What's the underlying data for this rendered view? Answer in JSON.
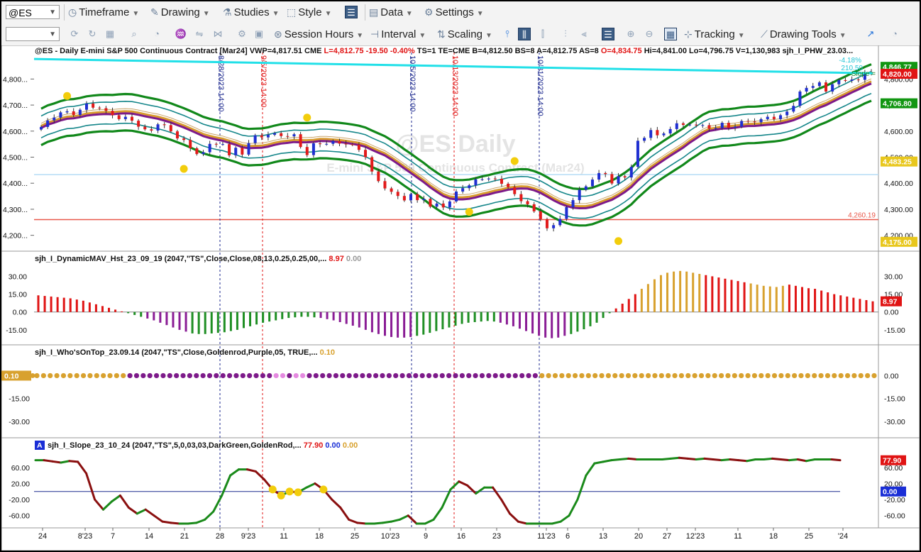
{
  "toolbar1": {
    "symbol": "@ES",
    "timeframe": "Timeframe",
    "drawing": "Drawing",
    "studies": "Studies",
    "style": "Style",
    "data": "Data",
    "settings": "Settings"
  },
  "toolbar2": {
    "session_hours": "Session Hours",
    "interval": "Interval",
    "scaling": "Scaling",
    "tracking": "Tracking",
    "drawing_tools": "Drawing Tools"
  },
  "chart_data": [
    {
      "type": "candlestick",
      "pane": "price",
      "header": [
        "@ES - Daily",
        "E-mini S&P 500 Continuous Contract [Mar24]",
        "VWP=4,817.51",
        "CME",
        "L=4,812.75",
        "-19.50",
        "-0.40%",
        "TS=1",
        "TE=CME",
        "B=4,812.50",
        "BS=8",
        "A=4,812.75",
        "AS=8",
        "O=4,834.75",
        "Hi=4,841.00",
        "Lo=4,796.75",
        "V=1,130,983",
        "sjh_I_PHW_23.03..."
      ],
      "watermark": [
        "@ES Daily",
        "E-mini S&P 500 Continuous Contract (Mar24)"
      ],
      "ylim": [
        4150,
        4880
      ],
      "y_ticks": [
        "4,800...",
        "4,700...",
        "4,600...",
        "4,500...",
        "4,400...",
        "4,300...",
        "4,200..."
      ],
      "right_ticks": [
        "4,800.00",
        "4,700.00",
        "4,600.00",
        "4,500.00",
        "4,400.00",
        "4,300.00",
        "4,200.00"
      ],
      "right_markers": [
        {
          "label": "4,846.77",
          "value": 4846.77,
          "color": "#119611"
        },
        {
          "label": "4,820.00",
          "value": 4820,
          "color": "#e01414"
        },
        {
          "label": "4,706.80",
          "value": 4706.8,
          "color": "#119611"
        },
        {
          "label": "4,483.25",
          "value": 4483.25,
          "color": "#e8c71d"
        },
        {
          "label": "4,175.00",
          "value": 4175,
          "color": "#e8c71d"
        }
      ],
      "horizontal_lines": [
        {
          "value": 4260.19,
          "label": "4,260.19",
          "color": "#e8584a"
        },
        {
          "value": 4433,
          "color": "#b5dcf5"
        }
      ],
      "trendline_labels": [
        "-4.18%",
        "210.50",
        "Slope ="
      ],
      "vertical_markers": [
        {
          "label": "8/28/2023 14:00",
          "color": "#1d2a8f"
        },
        {
          "label": "9/5/2023 14:00",
          "color": "#e01414"
        },
        {
          "label": "10/5/2023 14:00",
          "color": "#1d2a8f"
        },
        {
          "label": "10/13/2023 14:00",
          "color": "#e01414"
        },
        {
          "label": "10/31/2023 14:00",
          "color": "#1d2a8f"
        }
      ],
      "close": [
        4616,
        4641,
        4652,
        4672,
        4676,
        4662,
        4682,
        4706,
        4690,
        4688,
        4678,
        4661,
        4646,
        4655,
        4640,
        4617,
        4607,
        4602,
        4626,
        4623,
        4599,
        4572,
        4566,
        4534,
        4512,
        4519,
        4551,
        4550,
        4550,
        4507,
        4536,
        4510,
        4554,
        4584,
        4576,
        4586,
        4592,
        4581,
        4580,
        4588,
        4539,
        4508,
        4553,
        4550,
        4551,
        4562,
        4552,
        4549,
        4548,
        4528,
        4500,
        4445,
        4408,
        4380,
        4367,
        4351,
        4334,
        4358,
        4335,
        4340,
        4310,
        4322,
        4307,
        4330,
        4368,
        4381,
        4392,
        4415,
        4415,
        4418,
        4417,
        4398,
        4385,
        4358,
        4331,
        4319,
        4292,
        4262,
        4227,
        4239,
        4263,
        4308,
        4335,
        4375,
        4388,
        4414,
        4439,
        4435,
        4399,
        4427,
        4422,
        4463,
        4563,
        4574,
        4604,
        4584,
        4591,
        4608,
        4630,
        4624,
        4625,
        4622,
        4623,
        4609,
        4612,
        4632,
        4613,
        4617,
        4639,
        4637,
        4634,
        4646,
        4655,
        4646,
        4661,
        4675,
        4697,
        4752,
        4766,
        4773,
        4787,
        4752,
        4780,
        4796,
        4793,
        4798,
        4797,
        4826,
        4820
      ],
      "bands_last": {
        "top_green": 4846.77,
        "bottom_green": 4706.8
      }
    },
    {
      "type": "bar",
      "pane": "sjh_I_DynamicMAV_Hst",
      "label": "sjh_I_DynamicMAV_Hst_23_09_19 (2047,\"TS\",Close,Close,08,13,0.25,0.25,00,...",
      "values_text": [
        "8.97",
        "0.00"
      ],
      "ylim": [
        -24,
        38
      ],
      "ticks": [
        "30.00",
        "15.00",
        "0.00",
        "-15.00"
      ],
      "last": 8.97,
      "last_label": "8.97",
      "values": [
        14,
        13.5,
        13,
        12.5,
        12,
        11.5,
        10.5,
        9.5,
        8,
        6.5,
        5,
        3.5,
        2,
        0.5,
        -1,
        -2.5,
        -4,
        -5.5,
        -7,
        -9,
        -11,
        -13,
        -15,
        -16.5,
        -18,
        -18.5,
        -18.5,
        -18,
        -17.5,
        -17,
        -16,
        -15,
        -13.5,
        -12,
        -10.5,
        -9,
        -8,
        -7,
        -6,
        -5,
        -4.5,
        -4,
        -4,
        -4.5,
        -5,
        -6,
        -7,
        -8.5,
        -10,
        -11.5,
        -13,
        -15,
        -17,
        -18.5,
        -20,
        -21,
        -21.5,
        -21.5,
        -21,
        -20,
        -19,
        -17.5,
        -16,
        -14.5,
        -13,
        -11.5,
        -10,
        -9,
        -8.5,
        -8,
        -7.5,
        -8,
        -9,
        -10.5,
        -12,
        -14,
        -16,
        -18,
        -20,
        -21.5,
        -22,
        -21.5,
        -20,
        -18.5,
        -16.5,
        -14.5,
        -12,
        -9,
        -5,
        -1,
        3,
        7,
        11,
        15,
        19.5,
        23.5,
        27.5,
        31,
        33,
        34,
        34.5,
        34,
        33,
        32,
        31,
        30,
        29,
        28,
        27,
        26,
        25,
        24,
        23,
        22,
        21.5,
        21,
        22,
        23,
        22,
        21,
        20,
        19.5,
        18,
        16.5,
        15,
        14,
        13,
        12,
        11,
        10,
        8.97
      ]
    },
    {
      "type": "dots",
      "pane": "sjh_I_Who'sOnTop",
      "label": "sjh_I_Who'sOnTop_23.09.14 (2047,\"TS\",Close,Goldenrod,Purple,05,  TRUE,...",
      "values_text": [
        "0.10"
      ],
      "ylim": [
        -38,
        10
      ],
      "ticks": [
        "0.00",
        "-15.00",
        "-30.00"
      ],
      "last": 0.1,
      "last_label": "0.10",
      "colors": [
        "gold",
        "gold",
        "gold",
        "gold",
        "gold",
        "gold",
        "gold",
        "gold",
        "gold",
        "gold",
        "gold",
        "gold",
        "gold",
        "gold",
        "purple",
        "purple",
        "purple",
        "purple",
        "purple",
        "purple",
        "purple",
        "purple",
        "purple",
        "purple",
        "purple",
        "purple",
        "purple",
        "purple",
        "purple",
        "purple",
        "purple",
        "purple",
        "purple",
        "purple",
        "purple",
        "purple",
        "pink",
        "pink",
        "purple",
        "pink",
        "pink",
        "purple",
        "purple",
        "purple",
        "purple",
        "purple",
        "purple",
        "purple",
        "purple",
        "purple",
        "purple",
        "purple",
        "purple",
        "purple",
        "purple",
        "purple",
        "purple",
        "purple",
        "purple",
        "purple",
        "purple",
        "purple",
        "purple",
        "purple",
        "purple",
        "purple",
        "purple",
        "purple",
        "purple",
        "purple",
        "purple",
        "purple",
        "purple",
        "purple",
        "purple",
        "purple",
        "gold",
        "gold",
        "gold",
        "gold",
        "gold",
        "gold",
        "gold",
        "gold",
        "gold",
        "gold",
        "gold",
        "gold",
        "gold",
        "gold",
        "gold",
        "gold",
        "gold",
        "gold",
        "gold",
        "gold",
        "gold",
        "gold",
        "gold",
        "gold",
        "gold",
        "gold",
        "gold",
        "gold",
        "gold",
        "gold",
        "gold",
        "gold",
        "gold",
        "gold",
        "gold",
        "gold",
        "gold",
        "gold",
        "gold",
        "gold",
        "gold",
        "gold",
        "gold",
        "gold",
        "gold",
        "gold",
        "gold",
        "gold",
        "gold",
        "gold",
        "gold"
      ]
    },
    {
      "type": "line",
      "pane": "sjh_I_Slope",
      "label": "sjh_I_Slope_23_10_24 (2047,\"TS\",5,0,03,03,DarkGreen,GoldenRod,...",
      "values_text": [
        "77.90",
        "0.00",
        "0.00"
      ],
      "ylim": [
        -80,
        95
      ],
      "ticks": [
        "60.00",
        "20.00",
        "-20.00",
        "-60.00"
      ],
      "last": 77.9,
      "last_label": "77.90",
      "zero_label": "0.00",
      "values": [
        78,
        78,
        75,
        72,
        76,
        74,
        45,
        -20,
        -45,
        -25,
        -10,
        -40,
        -55,
        -45,
        -60,
        -75,
        -78,
        -80,
        -80,
        -78,
        -70,
        -50,
        -10,
        40,
        55,
        55,
        50,
        30,
        5,
        -10,
        0,
        -2,
        10,
        20,
        5,
        -20,
        -40,
        -70,
        -78,
        -80,
        -80,
        -78,
        -75,
        -70,
        -60,
        -80,
        -80,
        -70,
        -40,
        5,
        25,
        15,
        -5,
        10,
        10,
        -20,
        -55,
        -75,
        -80,
        -80,
        -80,
        -80,
        -75,
        -60,
        -20,
        40,
        70,
        74,
        78,
        80,
        82,
        80,
        80,
        80,
        80,
        82,
        84,
        82,
        80,
        82,
        80,
        78,
        80,
        78,
        76,
        80,
        80,
        82,
        80,
        78,
        80,
        76,
        80,
        80,
        80,
        77.9
      ],
      "gold_points": [
        28,
        29,
        30,
        31,
        34
      ],
      "x_labels": [
        "24",
        "8'23",
        "7",
        "14",
        "21",
        "28",
        "9'23",
        "11",
        "18",
        "25",
        "10'23",
        "9",
        "16",
        "23",
        "11'23",
        "6",
        "13",
        "20",
        "27",
        "12'23",
        "11",
        "18",
        "25",
        "'24"
      ]
    }
  ]
}
